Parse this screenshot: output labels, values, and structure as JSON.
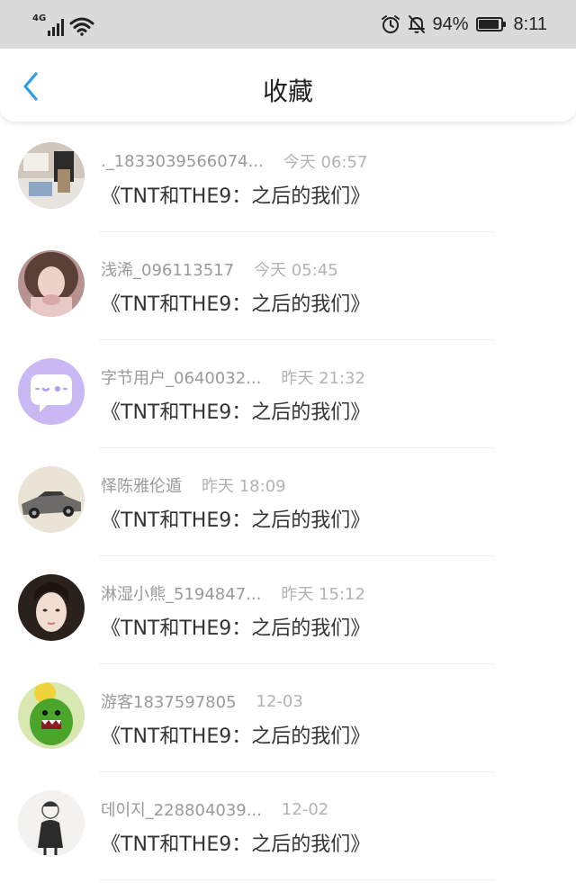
{
  "status_bar": {
    "network": "4G",
    "battery": "94%",
    "battery_fraction": 0.94,
    "time": "8:11",
    "icons": [
      "signal-icon",
      "wifi-icon",
      "alarm-icon",
      "bell-off-icon",
      "battery-icon"
    ]
  },
  "header": {
    "back_icon": "chevron-left-icon",
    "title": "收藏"
  },
  "colors": {
    "status_bar_bg": "#dadada",
    "accent": "#2c9ee8",
    "title_text": "#222222",
    "secondary_text": "#9a9a9a"
  },
  "favorites": [
    {
      "username": "._1833039566074...",
      "time": "今天 06:57",
      "work": "《TNT和THE9：之后的我们》",
      "avatar": "photo-avatar"
    },
    {
      "username": "浅浠_096113517",
      "time": "今天 05:45",
      "work": "《TNT和THE9：之后的我们》",
      "avatar": "photo-avatar"
    },
    {
      "username": "字节用户_0640032...",
      "time": "昨天 21:32",
      "work": "《TNT和THE9：之后的我们》",
      "avatar": "chat-bubble-avatar"
    },
    {
      "username": "怿陈雅伦遁",
      "time": "昨天 18:09",
      "work": "《TNT和THE9：之后的我们》",
      "avatar": "car-avatar"
    },
    {
      "username": "淋湿小熊_5194847...",
      "time": "昨天 15:12",
      "work": "《TNT和THE9：之后的我们》",
      "avatar": "photo-avatar"
    },
    {
      "username": "游客1837597805",
      "time": "12-03",
      "work": "《TNT和THE9：之后的我们》",
      "avatar": "green-monster-avatar"
    },
    {
      "username": "데이지_228804039...",
      "time": "12-02",
      "work": "《TNT和THE9：之后的我们》",
      "avatar": "drawing-avatar"
    }
  ]
}
